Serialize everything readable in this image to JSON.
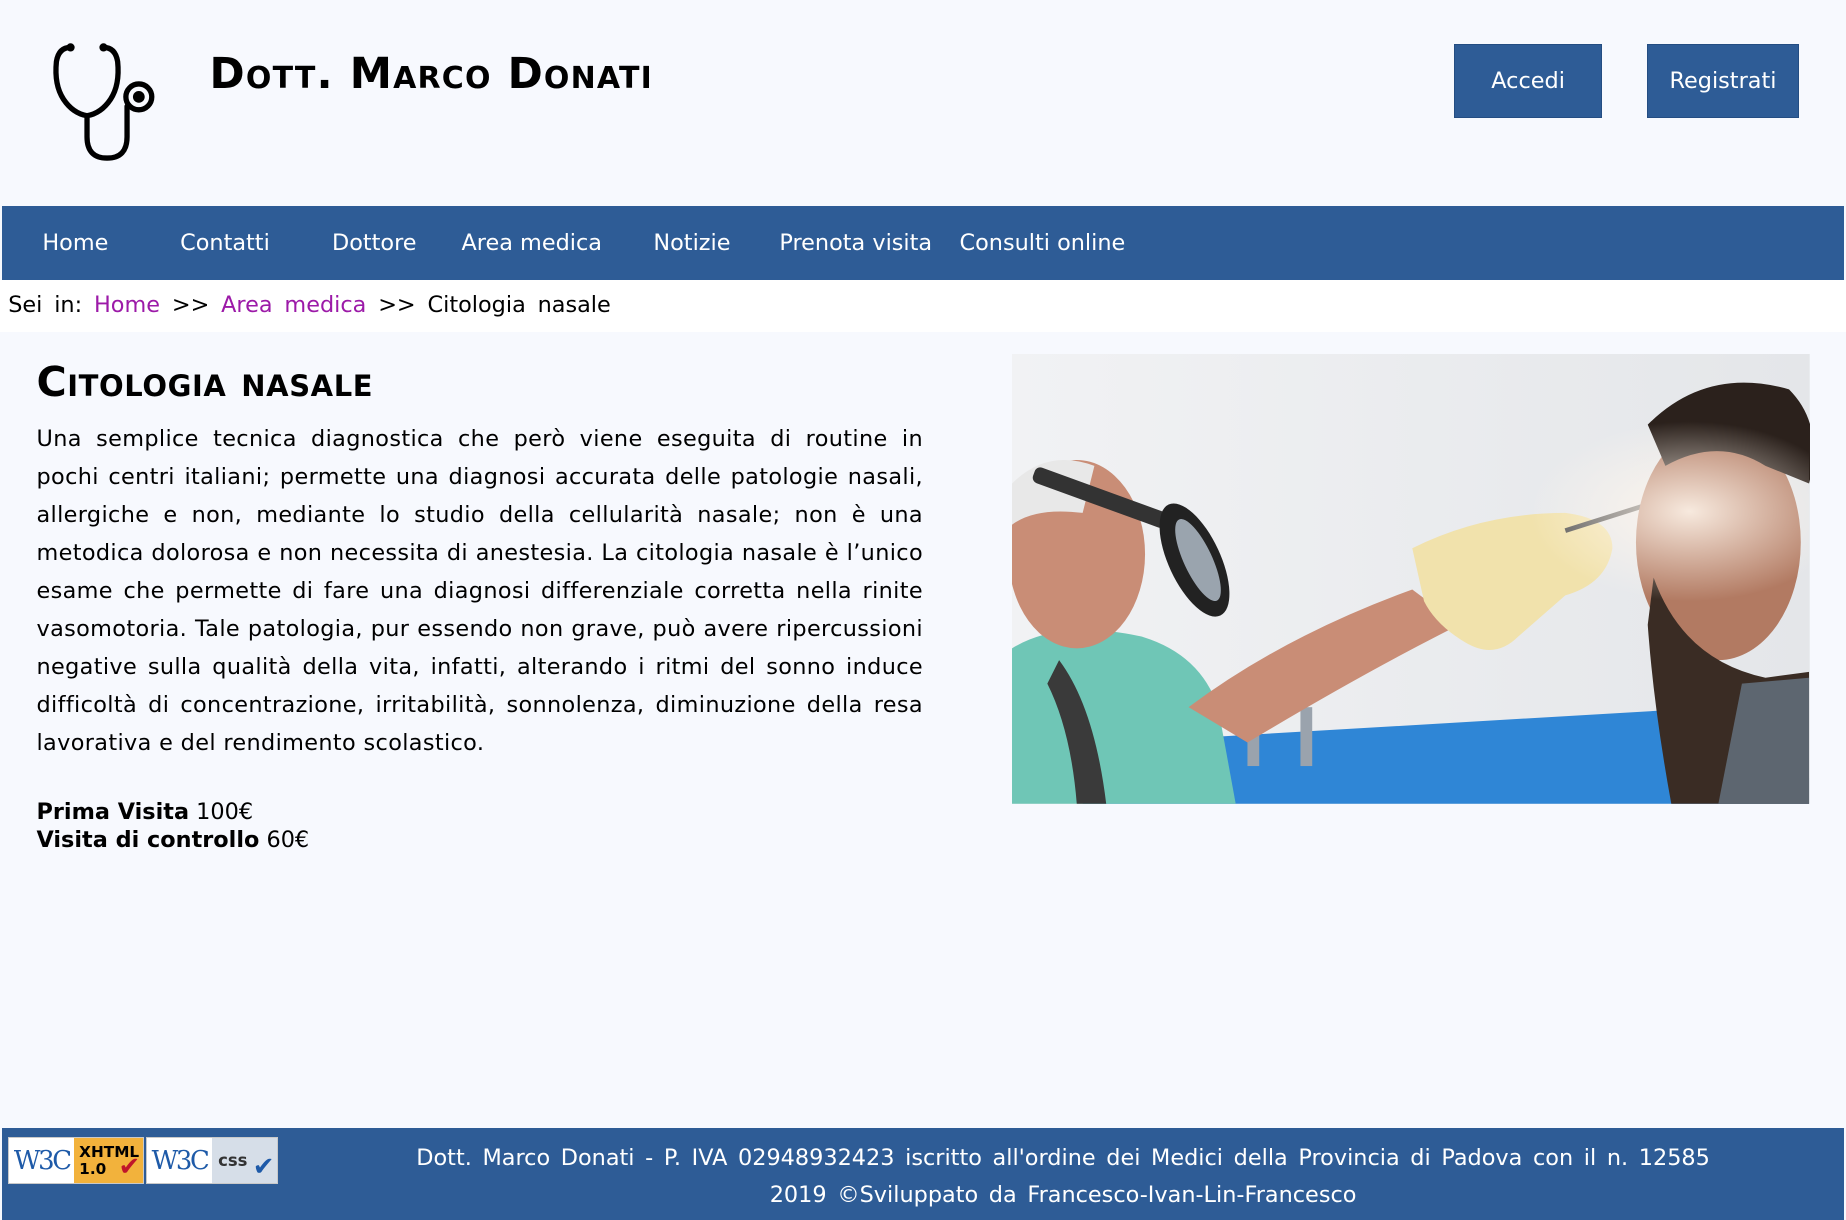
{
  "header": {
    "logo_icon": "stethoscope-icon",
    "site_title": "Dott. Marco Donati",
    "login_label": "Accedi",
    "register_label": "Registrati"
  },
  "nav": {
    "items": [
      "Home",
      "Contatti",
      "Dottore",
      "Area medica",
      "Notizie",
      "Prenota visita",
      "Consulti online"
    ]
  },
  "breadcrumb": {
    "prefix": "Sei in:",
    "home": "Home",
    "separator": ">>",
    "section": "Area medica",
    "current": "Citologia nasale"
  },
  "main": {
    "heading": "Citologia nasale",
    "intro": "Una semplice tecnica diagnostica che però viene eseguita di routine in pochi centri italiani; permette una diagnosi accurata delle patologie nasali, allergiche e non, mediante lo studio della cellularità nasale; non è una metodica dolorosa e non necessita di anestesia. La citologia nasale è l’unico esame che permette di fare una diagnosi differenziale corretta nella rinite vasomotoria. Tale patologia, pur essendo non grave, può avere ripercussioni negative sulla qualità della vita, infatti, alterando i ritmi del sonno induce difficoltà di concentrazione, irritabilità, sonnolenza, diminuzione della resa lavorativa e del rendimento scolastico.",
    "prices": [
      {
        "label": "Prima Visita",
        "value": "100€"
      },
      {
        "label": "Visita di controllo",
        "value": "60€"
      }
    ],
    "photo_icon": "nasal-exam-photo"
  },
  "footer": {
    "badges": [
      {
        "brand": "W3C",
        "label": "XHTML",
        "version": "1.0"
      },
      {
        "brand": "W3C",
        "label": "css"
      }
    ],
    "line1": "Dott. Marco Donati - P. IVA 02948932423 iscritto all'ordine dei Medici della Provincia di Padova con il n. 12585",
    "line2": "2019 ©Sviluppato da Francesco-Ivan-Lin-Francesco"
  },
  "colors": {
    "primary": "#2e5c96",
    "background": "#f7f9fe",
    "link": "#9c1aa8",
    "text": "#000000"
  }
}
